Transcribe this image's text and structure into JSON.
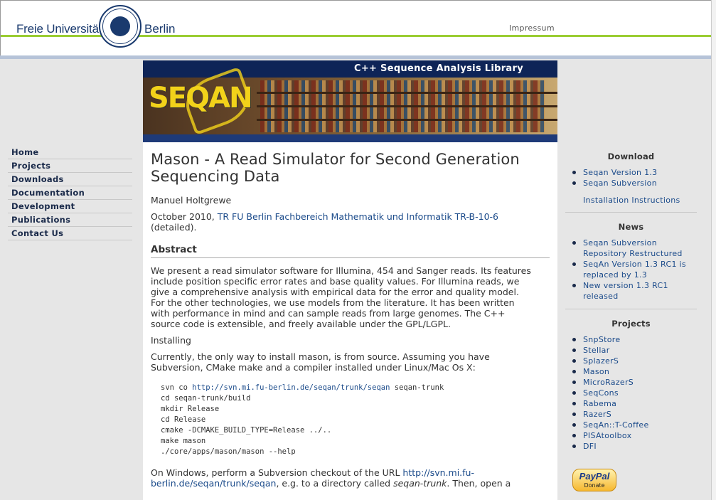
{
  "header": {
    "fu_left": "Freie Universität",
    "fu_right": "Berlin",
    "impressum": "Impressum"
  },
  "banner": {
    "title": "C++ Sequence Analysis Library",
    "logo": "SEQAN"
  },
  "nav": [
    {
      "label": "Home"
    },
    {
      "label": "Projects"
    },
    {
      "label": "Downloads"
    },
    {
      "label": "Documentation"
    },
    {
      "label": "Development"
    },
    {
      "label": "Publications"
    },
    {
      "label": "Contact Us"
    }
  ],
  "main": {
    "title": "Mason - A Read Simulator for Second Generation Sequencing Data",
    "author": "Manuel Holtgrewe",
    "pub_date": "October 2010, ",
    "pub_link": "TR FU Berlin Fachbereich Mathematik und Informatik TR-B-10-6",
    "pub_suffix": " (detailed).",
    "abstract_heading": "Abstract",
    "abstract": "We present a read simulator software for Illumina, 454 and Sanger reads. Its features include position specific error rates and base quality values. For Illumina reads, we give a comprehensive analysis with empirical data for the error and quality model. For the other technologies, we use models from the literature. It has been written with performance in mind and can sample reads from large genomes. The C++ source code is extensible, and freely available under the GPL/LGPL.",
    "installing": "Installing",
    "install_text": "Currently, the only way to install mason, is from source. Assuming you have Subversion, CMake make and a compiler installed under Linux/Mac Os X:",
    "code_prefix": "svn co ",
    "code_link": "http://svn.mi.fu-berlin.de/seqan/trunk/seqan",
    "code_suffix": " seqan-trunk",
    "code_lines": [
      "cd seqan-trunk/build",
      "mkdir Release",
      "cd Release",
      "cmake -DCMAKE_BUILD_TYPE=Release ../..",
      "make mason",
      "./core/apps/mason/mason --help"
    ],
    "windows_prefix": "On Windows, perform a Subversion checkout of the URL ",
    "windows_link": "http://svn.mi.fu-berlin.de/seqan/trunk/seqan",
    "windows_mid": ", e.g. to a directory called ",
    "windows_dir": "seqan-trunk",
    "windows_suffix": ". Then, open a"
  },
  "sidebar": {
    "download_title": "Download",
    "download_items": [
      "Seqan Version 1.3",
      "Seqan Subversion"
    ],
    "install_instructions": "Installation Instructions",
    "news_title": "News",
    "news_items": [
      "Seqan Subversion Repository Restructured",
      "SeqAn Version 1.3 RC1 is replaced by 1.3",
      "New version 1.3 RC1 released"
    ],
    "projects_title": "Projects",
    "project_items": [
      "SnpStore",
      "Stellar",
      "SplazerS",
      "Mason",
      "MicroRazerS",
      "SeqCons",
      "Rabema",
      "RazerS",
      "SeqAn::T-Coffee",
      "PISAtoolbox",
      "DFI"
    ],
    "paypal_logo": "PayPal",
    "paypal_label": "Donate"
  }
}
